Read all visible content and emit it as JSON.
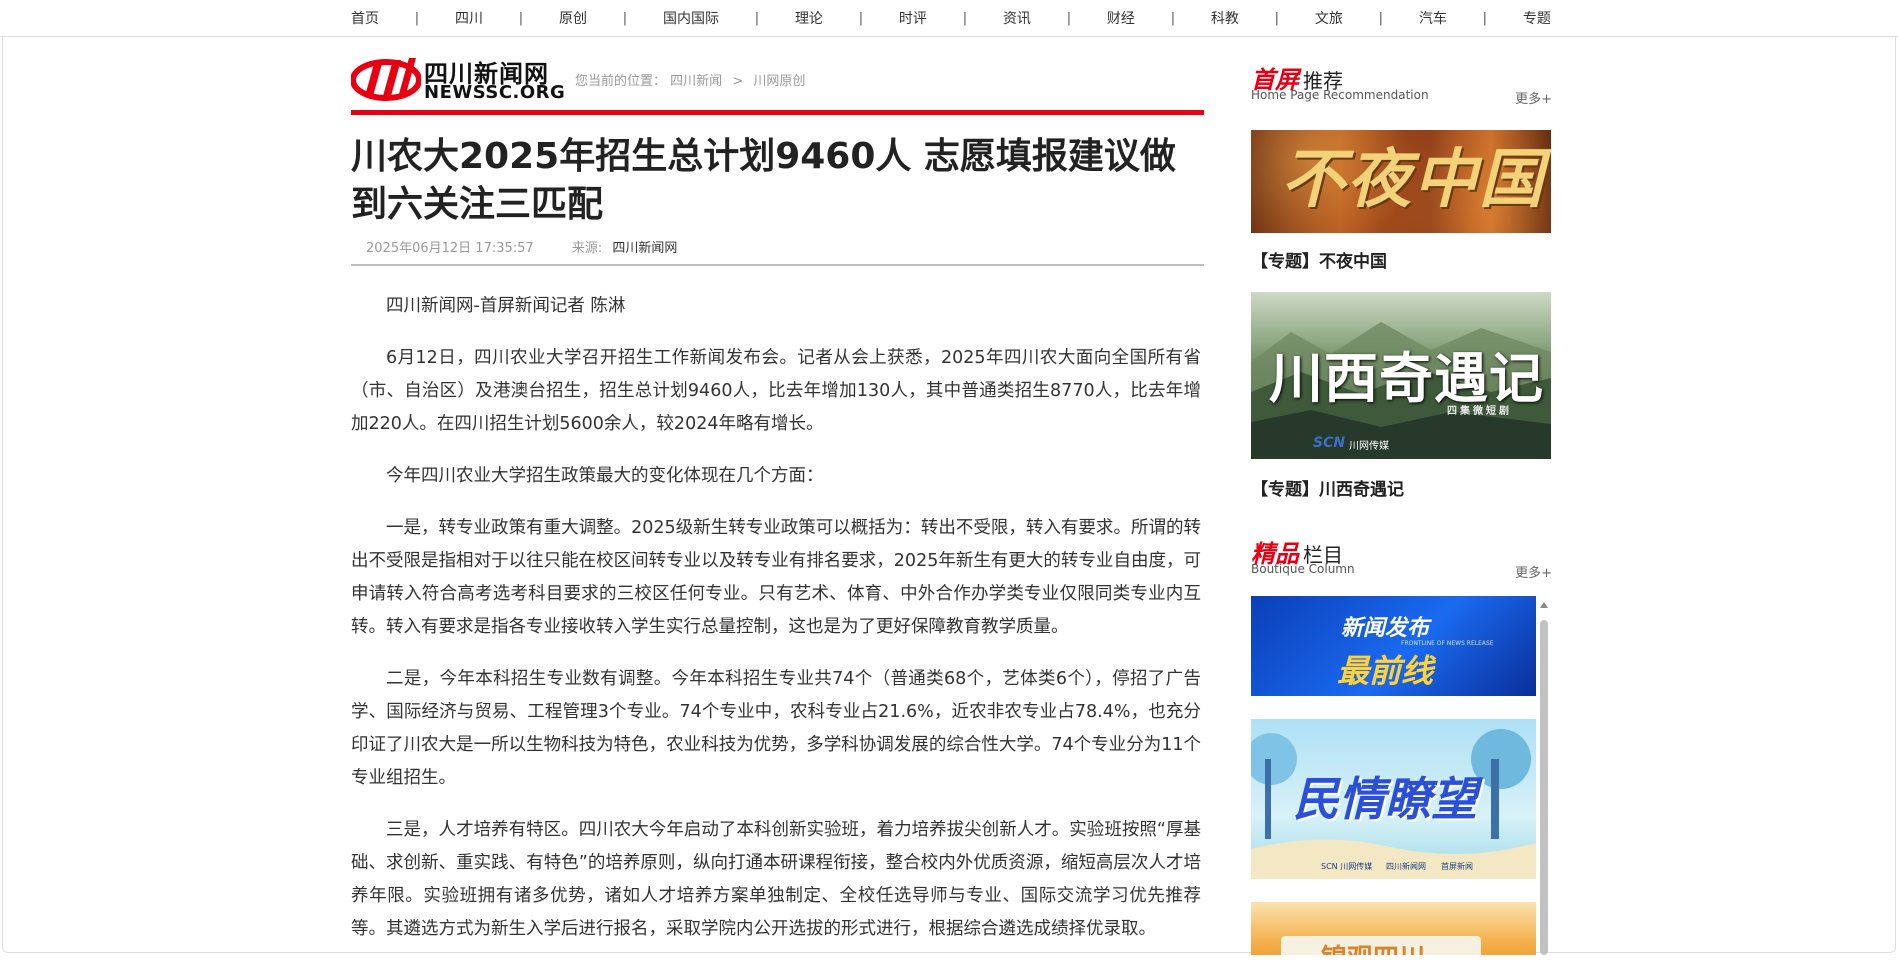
{
  "nav": {
    "items": [
      "首页",
      "四川",
      "原创",
      "国内国际",
      "理论",
      "时评",
      "资讯",
      "财经",
      "科教",
      "文旅",
      "汽车",
      "专题"
    ],
    "separator": "|"
  },
  "logo": {
    "cn": "四川新闻网",
    "en": "NEWSSC.ORG"
  },
  "breadcrumb": {
    "label": "您当前的位置：",
    "items": [
      "四川新闻",
      "川网原创"
    ],
    "separator": ">"
  },
  "article": {
    "title": "川农大2025年招生总计划9460人 志愿填报建议做到六关注三匹配",
    "datetime": "2025年06月12日 17:35:57",
    "source_label": "来源:",
    "source": "四川新闻网",
    "paragraphs": [
      "四川新闻网-首屏新闻记者 陈淋",
      "6月12日，四川农业大学召开招生工作新闻发布会。记者从会上获悉，2025年四川农大面向全国所有省（市、自治区）及港澳台招生，招生总计划9460人，比去年增加130人，其中普通类招生8770人，比去年增加220人。在四川招生计划5600余人，较2024年略有增长。",
      "今年四川农业大学招生政策最大的变化体现在几个方面：",
      "一是，转专业政策有重大调整。2025级新生转专业政策可以概括为：转出不受限，转入有要求。所谓的转出不受限是指相对于以往只能在校区间转专业以及转专业有排名要求，2025年新生有更大的转专业自由度，可申请转入符合高考选考科目要求的三校区任何专业。只有艺术、体育、中外合作办学类专业仅限同类专业内互转。转入有要求是指各专业接收转入学生实行总量控制，这也是为了更好保障教育教学质量。",
      "二是，今年本科招生专业数有调整。今年本科招生专业共74个（普通类68个，艺体类6个），停招了广告学、国际经济与贸易、工程管理3个专业。74个专业中，农科专业占21.6%，近农非农专业占78.4%，也充分印证了川农大是一所以生物科技为特色，农业科技为优势，多学科协调发展的综合性大学。74个专业分为11个专业组招生。",
      "三是，人才培养有特区。四川农大今年启动了本科创新实验班，着力培养拔尖创新人才。实验班按照“厚基础、求创新、重实践、有特色”的培养原则，纵向打通本研课程衔接，整合校内外优质资源，缩短高层次人才培养年限。实验班拥有诸多优势，诸如人才培养方案单独制定、全校任选导师与专业、国际交流学习优先推荐等。其遴选方式为新生入学后进行报名，采取学院内公开选拔的形式进行，根据综合遴选成绩择优录取。"
    ]
  },
  "sidebar": {
    "recommend": {
      "title_red": "首屏",
      "title_black": "推荐",
      "subtitle": "Home Page Recommendation",
      "more": "更多+",
      "items": [
        {
          "banner_text": "不夜中国",
          "caption": "【专题】不夜中国"
        },
        {
          "banner_text": "川西奇遇记",
          "banner_sub": "四集微短剧",
          "banner_logos": [
            "SCN",
            "川网传媒"
          ],
          "caption": "【专题】川西奇遇记"
        }
      ]
    },
    "boutique": {
      "title_red": "精品",
      "title_black": "栏目",
      "subtitle": "Boutique Column",
      "more": "更多+",
      "items": [
        {
          "banner_text": "新闻发布",
          "banner_text2": "最前线",
          "banner_en": "FRONTLINE OF NEWS RELEASE"
        },
        {
          "banner_text": "民情瞭望",
          "banner_logos": [
            "SCN 川网传媒",
            "四川新闻网",
            "首屏新闻"
          ]
        },
        {
          "banner_text": "锦观四川"
        }
      ]
    }
  },
  "colors": {
    "accent": "#e60012",
    "text": "#333333"
  },
  "icons": {
    "scroll_up": "triangle-up-icon"
  }
}
